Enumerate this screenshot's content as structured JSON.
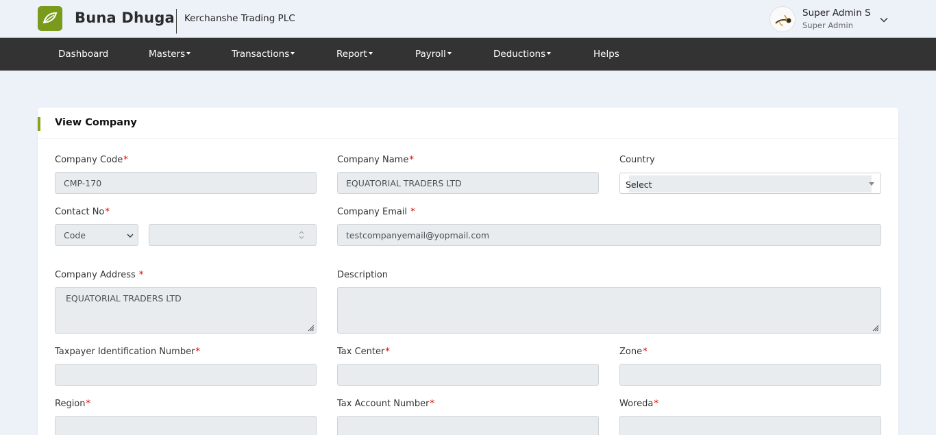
{
  "header": {
    "brand": "Buna Dhuga",
    "company": "Kerchanshe Trading PLC",
    "user_name": "Super Admin S",
    "user_role": "Super Admin"
  },
  "nav": {
    "dashboard": "Dashboard",
    "masters": "Masters",
    "transactions": "Transactions",
    "report": "Report",
    "payroll": "Payroll",
    "deductions": "Deductions",
    "helps": "Helps"
  },
  "page": {
    "title": "View Company"
  },
  "form": {
    "company_code": {
      "label": "Company Code",
      "value": "CMP-170"
    },
    "company_name": {
      "label": "Company Name",
      "value": "EQUATORIAL TRADERS LTD"
    },
    "country": {
      "label": "Country",
      "value": "Select"
    },
    "contact_no": {
      "label": "Contact No",
      "code_value": "Code",
      "number_value": ""
    },
    "company_email": {
      "label": "Company Email",
      "value": "testcompanyemail@yopmail.com"
    },
    "company_address": {
      "label": "Company Address",
      "value": "EQUATORIAL TRADERS LTD"
    },
    "description": {
      "label": "Description",
      "value": ""
    },
    "tin": {
      "label": "Taxpayer Identification Number",
      "value": ""
    },
    "tax_center": {
      "label": "Tax Center",
      "value": ""
    },
    "zone": {
      "label": "Zone",
      "value": ""
    },
    "region": {
      "label": "Region",
      "value": ""
    },
    "tax_account_number": {
      "label": "Tax Account Number",
      "value": ""
    },
    "woreda": {
      "label": "Woreda",
      "value": ""
    },
    "required_marker": "*"
  },
  "icons": {
    "logo": "leaf-logo-icon",
    "user_menu": "chevron-down-icon",
    "dropdown": "caret-down-icon"
  },
  "colors": {
    "brand_green": "#7a9a1c",
    "nav_bg": "#333333",
    "page_bg": "#edf1f8",
    "required_red": "#e00000"
  }
}
